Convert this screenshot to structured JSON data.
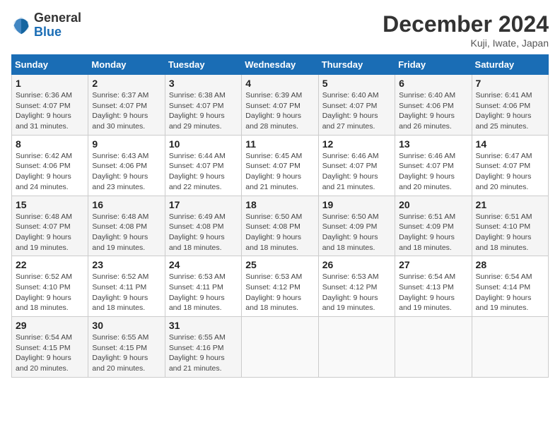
{
  "logo": {
    "general": "General",
    "blue": "Blue"
  },
  "header": {
    "month": "December 2024",
    "location": "Kuji, Iwate, Japan"
  },
  "weekdays": [
    "Sunday",
    "Monday",
    "Tuesday",
    "Wednesday",
    "Thursday",
    "Friday",
    "Saturday"
  ],
  "weeks": [
    [
      {
        "day": "1",
        "sunrise": "Sunrise: 6:36 AM",
        "sunset": "Sunset: 4:07 PM",
        "daylight": "Daylight: 9 hours and 31 minutes."
      },
      {
        "day": "2",
        "sunrise": "Sunrise: 6:37 AM",
        "sunset": "Sunset: 4:07 PM",
        "daylight": "Daylight: 9 hours and 30 minutes."
      },
      {
        "day": "3",
        "sunrise": "Sunrise: 6:38 AM",
        "sunset": "Sunset: 4:07 PM",
        "daylight": "Daylight: 9 hours and 29 minutes."
      },
      {
        "day": "4",
        "sunrise": "Sunrise: 6:39 AM",
        "sunset": "Sunset: 4:07 PM",
        "daylight": "Daylight: 9 hours and 28 minutes."
      },
      {
        "day": "5",
        "sunrise": "Sunrise: 6:40 AM",
        "sunset": "Sunset: 4:07 PM",
        "daylight": "Daylight: 9 hours and 27 minutes."
      },
      {
        "day": "6",
        "sunrise": "Sunrise: 6:40 AM",
        "sunset": "Sunset: 4:06 PM",
        "daylight": "Daylight: 9 hours and 26 minutes."
      },
      {
        "day": "7",
        "sunrise": "Sunrise: 6:41 AM",
        "sunset": "Sunset: 4:06 PM",
        "daylight": "Daylight: 9 hours and 25 minutes."
      }
    ],
    [
      {
        "day": "8",
        "sunrise": "Sunrise: 6:42 AM",
        "sunset": "Sunset: 4:06 PM",
        "daylight": "Daylight: 9 hours and 24 minutes."
      },
      {
        "day": "9",
        "sunrise": "Sunrise: 6:43 AM",
        "sunset": "Sunset: 4:06 PM",
        "daylight": "Daylight: 9 hours and 23 minutes."
      },
      {
        "day": "10",
        "sunrise": "Sunrise: 6:44 AM",
        "sunset": "Sunset: 4:07 PM",
        "daylight": "Daylight: 9 hours and 22 minutes."
      },
      {
        "day": "11",
        "sunrise": "Sunrise: 6:45 AM",
        "sunset": "Sunset: 4:07 PM",
        "daylight": "Daylight: 9 hours and 21 minutes."
      },
      {
        "day": "12",
        "sunrise": "Sunrise: 6:46 AM",
        "sunset": "Sunset: 4:07 PM",
        "daylight": "Daylight: 9 hours and 21 minutes."
      },
      {
        "day": "13",
        "sunrise": "Sunrise: 6:46 AM",
        "sunset": "Sunset: 4:07 PM",
        "daylight": "Daylight: 9 hours and 20 minutes."
      },
      {
        "day": "14",
        "sunrise": "Sunrise: 6:47 AM",
        "sunset": "Sunset: 4:07 PM",
        "daylight": "Daylight: 9 hours and 20 minutes."
      }
    ],
    [
      {
        "day": "15",
        "sunrise": "Sunrise: 6:48 AM",
        "sunset": "Sunset: 4:07 PM",
        "daylight": "Daylight: 9 hours and 19 minutes."
      },
      {
        "day": "16",
        "sunrise": "Sunrise: 6:48 AM",
        "sunset": "Sunset: 4:08 PM",
        "daylight": "Daylight: 9 hours and 19 minutes."
      },
      {
        "day": "17",
        "sunrise": "Sunrise: 6:49 AM",
        "sunset": "Sunset: 4:08 PM",
        "daylight": "Daylight: 9 hours and 18 minutes."
      },
      {
        "day": "18",
        "sunrise": "Sunrise: 6:50 AM",
        "sunset": "Sunset: 4:08 PM",
        "daylight": "Daylight: 9 hours and 18 minutes."
      },
      {
        "day": "19",
        "sunrise": "Sunrise: 6:50 AM",
        "sunset": "Sunset: 4:09 PM",
        "daylight": "Daylight: 9 hours and 18 minutes."
      },
      {
        "day": "20",
        "sunrise": "Sunrise: 6:51 AM",
        "sunset": "Sunset: 4:09 PM",
        "daylight": "Daylight: 9 hours and 18 minutes."
      },
      {
        "day": "21",
        "sunrise": "Sunrise: 6:51 AM",
        "sunset": "Sunset: 4:10 PM",
        "daylight": "Daylight: 9 hours and 18 minutes."
      }
    ],
    [
      {
        "day": "22",
        "sunrise": "Sunrise: 6:52 AM",
        "sunset": "Sunset: 4:10 PM",
        "daylight": "Daylight: 9 hours and 18 minutes."
      },
      {
        "day": "23",
        "sunrise": "Sunrise: 6:52 AM",
        "sunset": "Sunset: 4:11 PM",
        "daylight": "Daylight: 9 hours and 18 minutes."
      },
      {
        "day": "24",
        "sunrise": "Sunrise: 6:53 AM",
        "sunset": "Sunset: 4:11 PM",
        "daylight": "Daylight: 9 hours and 18 minutes."
      },
      {
        "day": "25",
        "sunrise": "Sunrise: 6:53 AM",
        "sunset": "Sunset: 4:12 PM",
        "daylight": "Daylight: 9 hours and 18 minutes."
      },
      {
        "day": "26",
        "sunrise": "Sunrise: 6:53 AM",
        "sunset": "Sunset: 4:12 PM",
        "daylight": "Daylight: 9 hours and 19 minutes."
      },
      {
        "day": "27",
        "sunrise": "Sunrise: 6:54 AM",
        "sunset": "Sunset: 4:13 PM",
        "daylight": "Daylight: 9 hours and 19 minutes."
      },
      {
        "day": "28",
        "sunrise": "Sunrise: 6:54 AM",
        "sunset": "Sunset: 4:14 PM",
        "daylight": "Daylight: 9 hours and 19 minutes."
      }
    ],
    [
      {
        "day": "29",
        "sunrise": "Sunrise: 6:54 AM",
        "sunset": "Sunset: 4:15 PM",
        "daylight": "Daylight: 9 hours and 20 minutes."
      },
      {
        "day": "30",
        "sunrise": "Sunrise: 6:55 AM",
        "sunset": "Sunset: 4:15 PM",
        "daylight": "Daylight: 9 hours and 20 minutes."
      },
      {
        "day": "31",
        "sunrise": "Sunrise: 6:55 AM",
        "sunset": "Sunset: 4:16 PM",
        "daylight": "Daylight: 9 hours and 21 minutes."
      },
      null,
      null,
      null,
      null
    ]
  ]
}
